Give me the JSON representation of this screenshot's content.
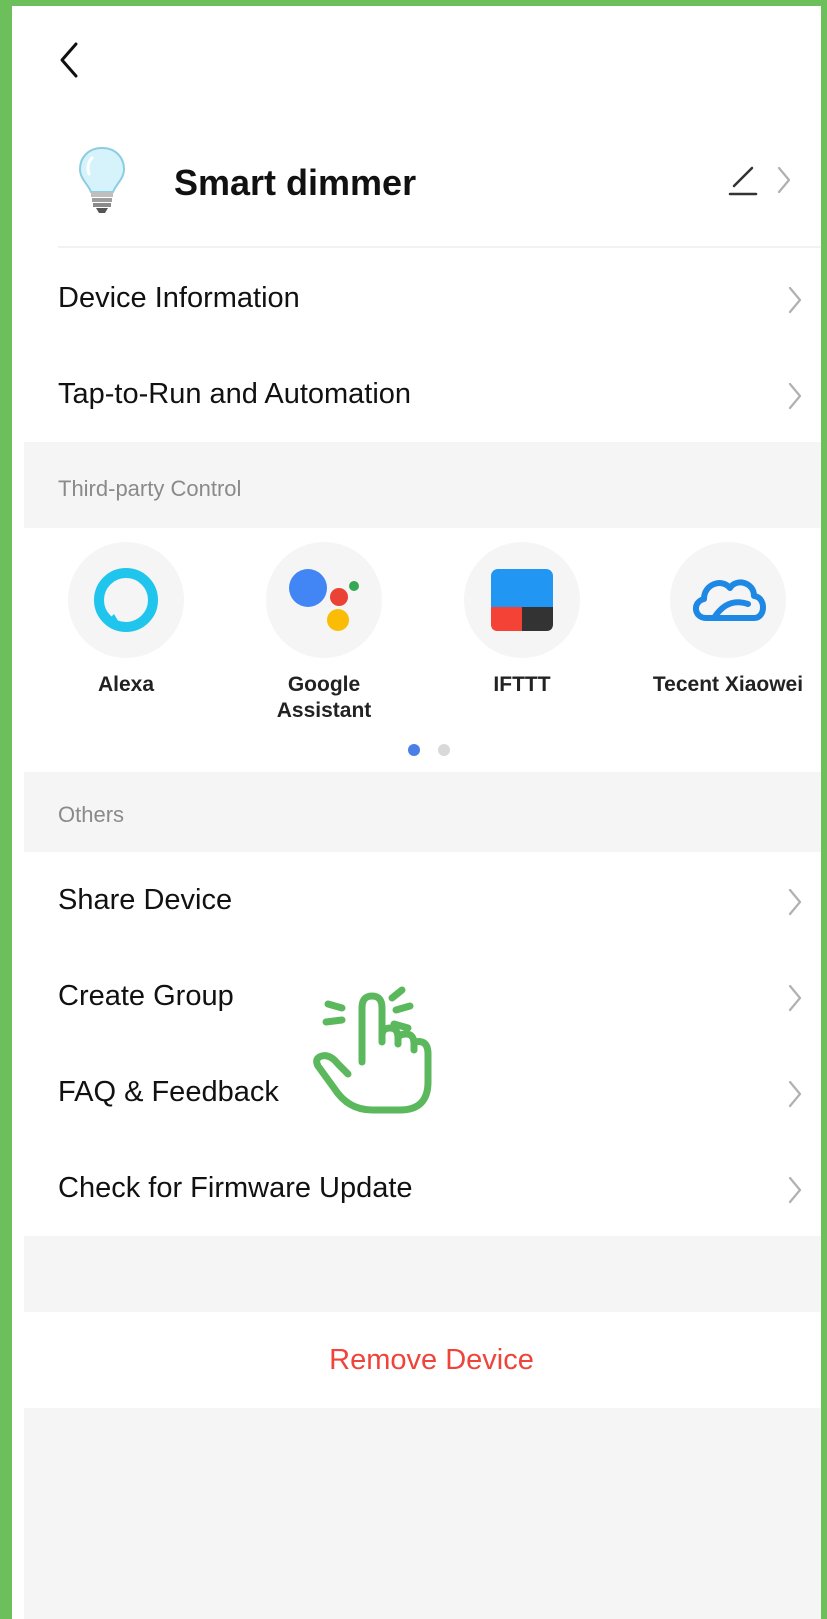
{
  "header": {
    "device_name": "Smart dimmer",
    "icons": {
      "back": "chevron-left-icon",
      "device": "light-bulb-icon",
      "edit": "pencil-icon",
      "open": "chevron-right-icon"
    }
  },
  "menu": {
    "device_information": "Device Information",
    "tap_to_run": "Tap-to-Run and Automation"
  },
  "third_party": {
    "section_title": "Third-party Control",
    "items": [
      {
        "name": "Alexa",
        "icon": "alexa-icon"
      },
      {
        "name": "Google\nAssistant",
        "icon": "google-assistant-icon"
      },
      {
        "name": "IFTTT",
        "icon": "ifttt-icon"
      },
      {
        "name": "Tecent Xiaowei",
        "icon": "cloud-icon"
      }
    ],
    "pager": {
      "active_page": 1,
      "total_pages": 2
    }
  },
  "others": {
    "section_title": "Others",
    "share_device": "Share Device",
    "create_group": "Create Group",
    "faq_feedback": "FAQ & Feedback",
    "firmware_update": "Check for Firmware Update"
  },
  "remove_device": "Remove Device",
  "overlay": {
    "icon": "tap-hand-icon"
  },
  "colors": {
    "frame": "#6cbf5a",
    "remove": "#f0433a",
    "page_dot_active": "#4a7fe8",
    "page_dot_inactive": "#d9d9d9",
    "section_bg": "#f5f5f5"
  }
}
